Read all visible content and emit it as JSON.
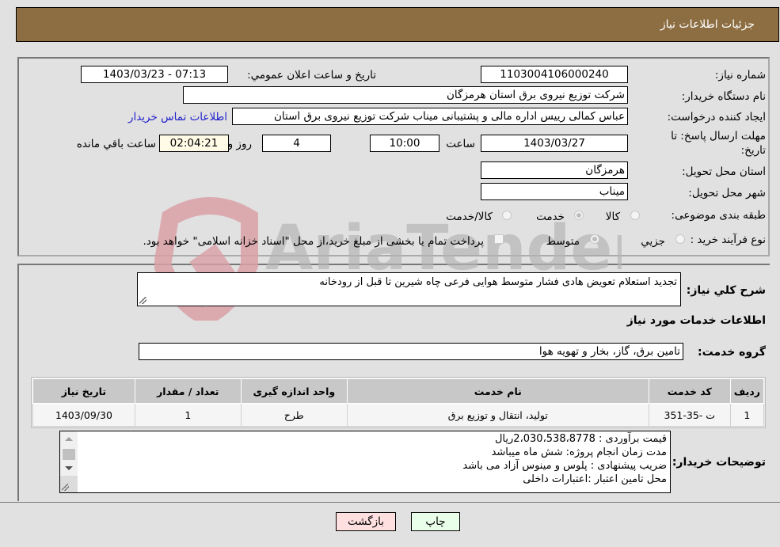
{
  "header": {
    "title": "جزئیات اطلاعات نیاز"
  },
  "fields": {
    "need_number_label": "شماره نیاز:",
    "need_number": "1103004106000240",
    "announce_label": "تاریخ و ساعت اعلان عمومي:",
    "announce_value": "1403/03/23 - 07:13",
    "buyer_org_label": "نام دستگاه خریدار:",
    "buyer_org": "شرکت توزیع نیروی برق استان هرمزگان",
    "creator_label": "ایجاد کننده درخواست:",
    "creator": "عباس کمالی رییس اداره مالی و پشتیبانی میناب شرکت توزیع نیروی برق استان",
    "buyer_contact_link": "اطلاعات تماس خریدار",
    "deadline_label_1": "مهلت ارسال پاسخ: تا",
    "deadline_label_2": "تاریخ:",
    "deadline_date": "1403/03/27",
    "time_label": "ساعت",
    "deadline_time": "10:00",
    "days_value": "4",
    "days_label": "روز و",
    "remaining_time": "02:04:21",
    "remaining_label": "ساعت باقي مانده",
    "province_label": "استان محل تحویل:",
    "province": "هرمزگان",
    "city_label": "شهر محل تحویل:",
    "city": "میناب",
    "category_label": "طبقه بندی موضوعی:",
    "category_options": [
      "کالا",
      "خدمت",
      "کالا/خدمت"
    ],
    "category_selected": "خدمت",
    "process_label": "نوع فرآیند خرید :",
    "process_options": [
      "جزيي",
      "متوسط"
    ],
    "process_selected": "متوسط",
    "treasury_note": "پرداخت تمام یا بخشی از مبلغ خرید،از محل \"اسناد خزانه اسلامی\" خواهد بود."
  },
  "description": {
    "label": "شرح کلي نیاز:",
    "value": "تجدید استعلام تعویض هادی فشار متوسط هوایی فرعی چاه شیرین تا قبل از رودخانه"
  },
  "services": {
    "section_title": "اطلاعات خدمات مورد نیاز",
    "group_label": "گروه خدمت:",
    "group_value": "تامین برق، گاز، بخار و تهویه هوا",
    "table": {
      "headers": [
        "ردیف",
        "کد خدمت",
        "نام خدمت",
        "واحد اندازه گیری",
        "تعداد / مقدار",
        "تاریخ نیاز"
      ],
      "rows": [
        [
          "1",
          "ت -35-351",
          "تولید، انتقال و توزیع برق",
          "طرح",
          "1",
          "1403/09/30"
        ]
      ]
    }
  },
  "buyer_notes": {
    "label": "توضیحات خریدار:",
    "lines": [
      "قیمت برآوردی : 2،030،538،8778ریال",
      "مدت زمان انجام پروژه: شش ماه میباشد",
      "ضریب پیشنهادی : پلوس و مینوس آزاد می باشد",
      "محل تامین اعتبار :اعتبارات داخلی"
    ]
  },
  "buttons": {
    "print": "چاپ",
    "back": "بازگشت"
  },
  "watermark": {
    "text": "AriaTender.neT"
  },
  "colors": {
    "header_bg": "#8d6e43",
    "link": "#2222cc",
    "back_btn": "#ffe0e0",
    "print_btn": "#eaffea",
    "remaining_bg": "#fffbe6"
  }
}
